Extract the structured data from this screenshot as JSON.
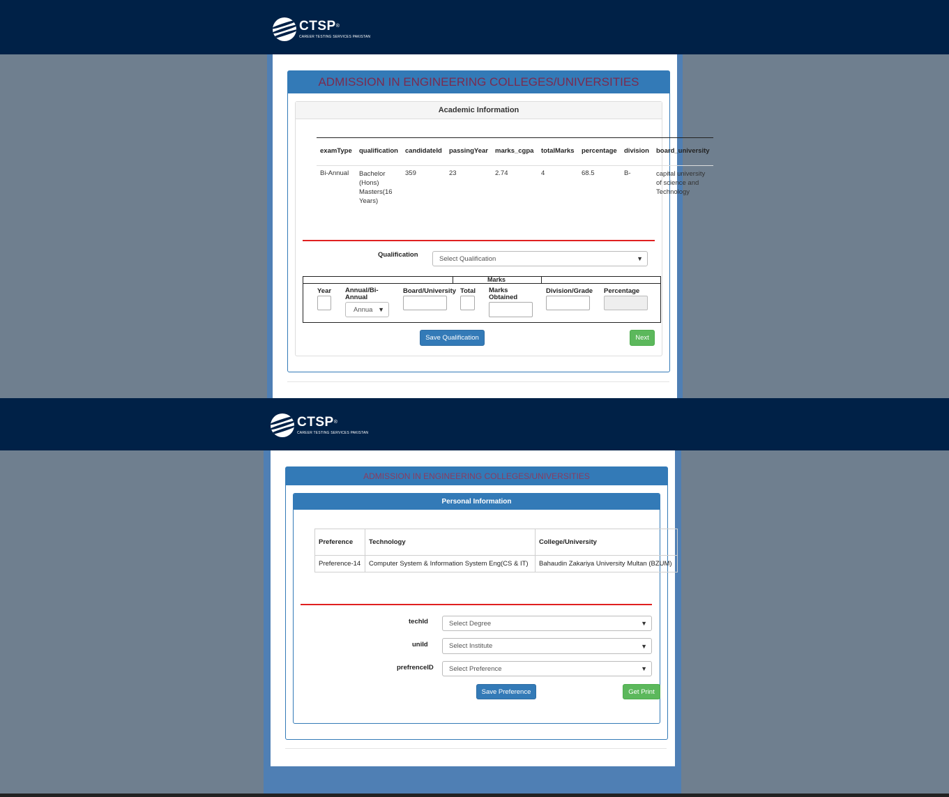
{
  "brand": {
    "name": "CTSP",
    "reg": "®",
    "tagline": "CAREER TESTING SERVICES PAKISTAN"
  },
  "page_title": "ADMISSION IN ENGINEERING COLLEGES/UNIVERSITIES",
  "academic": {
    "section_title": "Academic Information",
    "columns": [
      "examType",
      "qualification",
      "candidateId",
      "passingYear",
      "marks_cgpa",
      "totalMarks",
      "percentage",
      "division",
      "board_university"
    ],
    "row": {
      "examType": "Bi-Annual",
      "qualification": [
        "Bachelor",
        "(Hons)",
        "Masters(16",
        "Years)"
      ],
      "candidateId": "359",
      "passingYear": "23",
      "marks_cgpa": "2.74",
      "totalMarks": "4",
      "percentage": "68.5",
      "division": "B-",
      "board_university": [
        "capital university",
        "of science and",
        "Technology"
      ]
    }
  },
  "qualification_form": {
    "label": "Qualification",
    "select_placeholder": "Select Qualification",
    "marks_group": "Marks",
    "fields": {
      "year": "Year",
      "annual_l1": "Annual/Bi-",
      "annual_l2": "Annual",
      "board": "Board/University",
      "total": "Total",
      "marks_l1": "Marks",
      "marks_l2": "Obtained",
      "division": "Division/Grade",
      "percentage": "Percentage"
    },
    "annual_value": "Annua",
    "save_button": "Save Qualification",
    "next_button": "Next"
  },
  "personal": {
    "section_title": "Personal Information",
    "columns": [
      "Preference",
      "Technology",
      "College/University"
    ],
    "row": {
      "preference": "Preference-14",
      "technology": "Computer System & Information System Eng(CS & IT)",
      "college": "Bahaudin Zakariya University Multan (BZUM)"
    },
    "fields": [
      {
        "label": "techId",
        "placeholder": "Select Degree"
      },
      {
        "label": "uniId",
        "placeholder": "Select Institute"
      },
      {
        "label": "prefrenceID",
        "placeholder": "Select Preference"
      }
    ],
    "save_button": "Save Preference",
    "print_button": "Get Print"
  },
  "colors": {
    "navy": "#002147",
    "primary": "#337ab7",
    "success": "#5cb85c",
    "divider": "#e02020",
    "title": "#7b2b4f"
  }
}
